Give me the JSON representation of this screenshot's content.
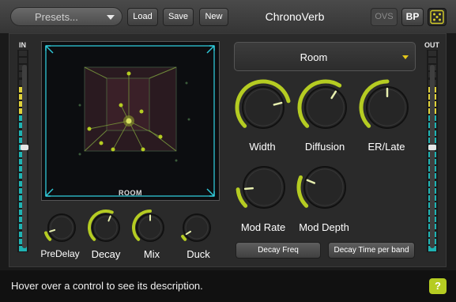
{
  "toolbar": {
    "presets_label": "Presets...",
    "load_label": "Load",
    "save_label": "Save",
    "new_label": "New",
    "plugin_title": "ChronoVerb",
    "ovs_label": "OVS",
    "bp_label": "BP"
  },
  "meters": {
    "in_label": "IN",
    "out_label": "OUT",
    "in_slider_level": 0.55,
    "out_slider_level": 0.55
  },
  "room_view": {
    "label": "ROOM"
  },
  "room_select": {
    "value": "Room"
  },
  "knobs": {
    "width": {
      "label": "Width",
      "value": 0.78
    },
    "diffusion": {
      "label": "Diffusion",
      "value": 0.62
    },
    "er_late": {
      "label": "ER/Late",
      "value": 0.5
    },
    "mod_rate": {
      "label": "Mod Rate",
      "value": 0.15
    },
    "mod_depth": {
      "label": "Mod Depth",
      "value": 0.25
    },
    "predelay": {
      "label": "PreDelay",
      "value": 0.1
    },
    "decay": {
      "label": "Decay",
      "value": 0.58
    },
    "mix": {
      "label": "Mix",
      "value": 0.5
    },
    "duck": {
      "label": "Duck",
      "value": 0.05
    }
  },
  "buttons": {
    "decay_freq": "Decay Freq",
    "decay_time_per_band": "Decay Time per band"
  },
  "status": {
    "text": "Hover over a control to see its description.",
    "help_label": "?"
  },
  "colors": {
    "accent": "#b5cc22",
    "meter_yellow": "#e0d23a",
    "meter_teal": "#1fb3b3",
    "room_frame": "#2fc6d6"
  }
}
